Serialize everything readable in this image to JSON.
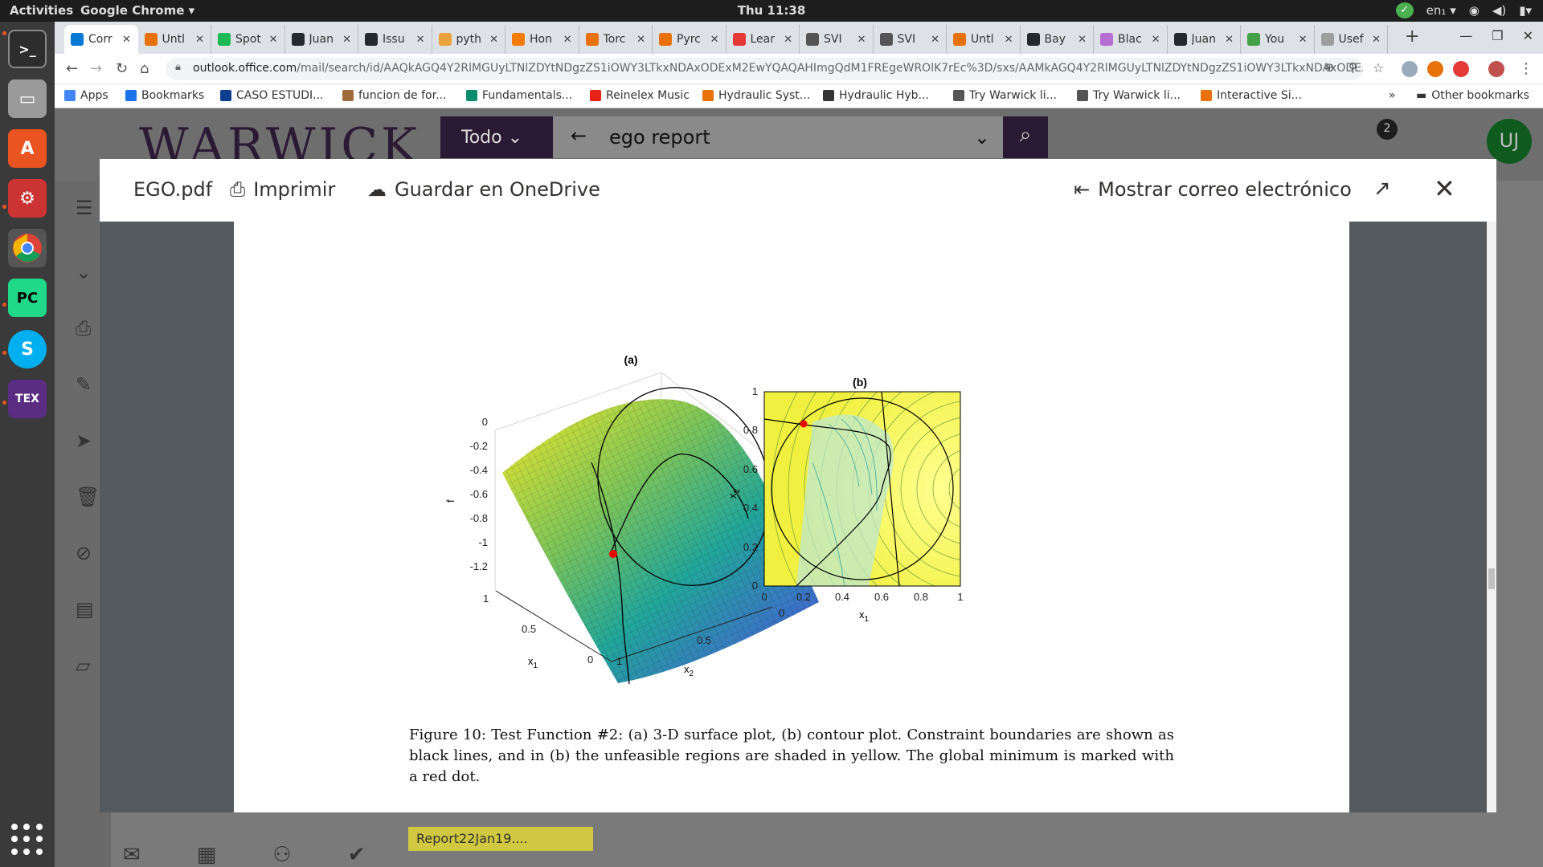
{
  "topbar": {
    "activities": "Activities",
    "app_name": "Google Chrome ▾",
    "clock": "Thu 11:38",
    "lang": "en₁ ▾",
    "check": "✓"
  },
  "browser": {
    "tabs": [
      {
        "title": "Corr",
        "color": "#0078d4"
      },
      {
        "title": "Untl",
        "color": "#e8710a"
      },
      {
        "title": "Spot",
        "color": "#1db954"
      },
      {
        "title": "Juan",
        "color": "#24292e"
      },
      {
        "title": "Issu",
        "color": "#24292e"
      },
      {
        "title": "pyth",
        "color": "#e8a33d"
      },
      {
        "title": "Hon",
        "color": "#f57c00"
      },
      {
        "title": "Torc",
        "color": "#e8710a"
      },
      {
        "title": "Pyrc",
        "color": "#e8710a"
      },
      {
        "title": "Lear",
        "color": "#e53935"
      },
      {
        "title": "SVI",
        "color": "#555"
      },
      {
        "title": "SVI",
        "color": "#555"
      },
      {
        "title": "Untl",
        "color": "#e8710a"
      },
      {
        "title": "Bay",
        "color": "#24292e"
      },
      {
        "title": "Blac",
        "color": "#b56ed1"
      },
      {
        "title": "Juan",
        "color": "#24292e"
      },
      {
        "title": "You",
        "color": "#43a047"
      },
      {
        "title": "Usef",
        "color": "#9e9e9e"
      }
    ],
    "url_host": "outlook.office.com",
    "url_path": "/mail/search/id/AAQkAGQ4Y2RlMGUyLTNlZDYtNDgzZS1iOWY3LTkxNDAxODExM2EwYQAQAHImgQdM1FREgeWROlK7rEc%3D/sxs/AAMkAGQ4Y2RlMGUyLTNlZDYtNDgzZS1iOWY3LTkxNDAxODExM...",
    "bookmarks": [
      {
        "label": "Apps",
        "color": "#4285f4"
      },
      {
        "label": "Bookmarks",
        "color": "#1a73e8"
      },
      {
        "label": "CASO ESTUDI...",
        "color": "#0b3d91"
      },
      {
        "label": "funcion de for...",
        "color": "#9e6b3a"
      },
      {
        "label": "Fundamentals...",
        "color": "#0c8c6c"
      },
      {
        "label": "Reinelex Music",
        "color": "#e62117"
      },
      {
        "label": "Hydraulic Syst...",
        "color": "#e8710a"
      },
      {
        "label": "Hydraulic Hyb...",
        "color": "#333"
      },
      {
        "label": "Try Warwick li...",
        "color": "#555"
      },
      {
        "label": "Try Warwick li...",
        "color": "#555"
      },
      {
        "label": "Interactive Si...",
        "color": "#e8710a"
      }
    ],
    "bookmarks_more": "»",
    "other_bookmarks": "Other bookmarks"
  },
  "owa": {
    "logo": "WARWICK",
    "scope": "Todo",
    "search_query": "ego report",
    "notif_count": "2",
    "avatar_initials": "UJ",
    "attachment": "Report22Jan19...."
  },
  "viewer": {
    "file_name": "EGO.pdf",
    "print_label": "Imprimir",
    "save_label": "Guardar en OneDrive",
    "show_email_label": "Mostrar correo electrónico"
  },
  "figure": {
    "panel_a_title": "(a)",
    "panel_b_title": "(b)",
    "a_zlabel": "f",
    "a_zticks": [
      "0",
      "-0.2",
      "-0.4",
      "-0.6",
      "-0.8",
      "-1",
      "-1.2"
    ],
    "a_x1label": "x",
    "a_x1sub": "1",
    "a_x1ticks": [
      "1",
      "0.5",
      "0"
    ],
    "a_x2label": "x",
    "a_x2sub": "2",
    "a_x2ticks": [
      "1",
      "0.5",
      "0"
    ],
    "b_xlabel": "x",
    "b_xsub": "1",
    "b_ylabel": "x",
    "b_ysub": "2",
    "b_xticks": [
      "0",
      "0.2",
      "0.4",
      "0.6",
      "0.8",
      "1"
    ],
    "b_yticks": [
      "0",
      "0.2",
      "0.4",
      "0.6",
      "0.8",
      "1"
    ],
    "caption": "Figure 10: Test Function #2: (a) 3-D surface plot, (b) contour plot. Constraint boundaries are shown as black lines, and in (b) the unfeasible regions are shaded in yellow. The global minimum is marked with a red dot."
  }
}
